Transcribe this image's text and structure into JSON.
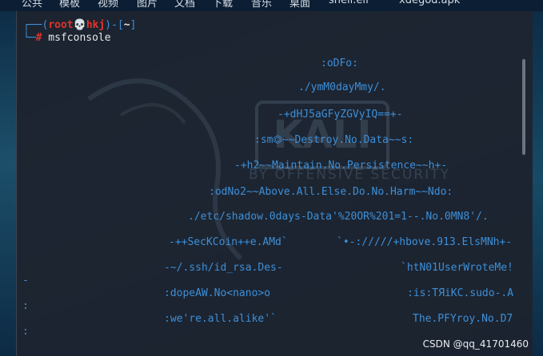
{
  "desktop": {
    "top_labels": [
      "公共",
      "模板",
      "视频",
      "图片",
      "文档",
      "下载",
      "音乐",
      "桌面",
      "shell.elf",
      "xdegod.apk"
    ]
  },
  "terminal": {
    "prompt": {
      "bracket_open": "┌──(",
      "user": "root",
      "skull": "💀",
      "host": "hkj",
      "bracket_mid": ")-[",
      "path": "~",
      "bracket_close": "]",
      "second_prefix": "└─",
      "hash": "#",
      "command": " msfconsole"
    },
    "banner_lines": [
      ":oDFo:",
      "./ymM0dayMmy/.",
      "-+dHJ5aGFyZGVyIQ==+-",
      ":sm⏣~~Destroy.No.Data~~s:",
      "-+h2~~Maintain.No.Persistence~~h+-",
      ":odNo2~~Above.All.Else.Do.No.Harm~~Ndo:",
      "./etc/shadow.0days-Data'%20OR%201=1--.No.0MN8'/.",
      "-++SecKCoin++e.AMd`",
      "`•-://///+hbove.913.ElsMNh+-",
      "-~/.ssh/id_rsa.Des-",
      "`htN01UserWroteMe!",
      "-",
      ":dopeAW.No<nano>o",
      ":is:TЯiKC.sudo-.A",
      ":",
      ":we're.all.alike'`",
      "The.PFYroy.No.D7",
      ":"
    ],
    "watermark": {
      "logo_text": "KALI",
      "tagline": "BY OFFENSIVE SECURITY"
    }
  },
  "credit": "CSDN @qq_41701460",
  "colors": {
    "banner_blue": "#3d8fd8",
    "prompt_red": "#e0342b",
    "terminal_bg": "#1e2430"
  }
}
